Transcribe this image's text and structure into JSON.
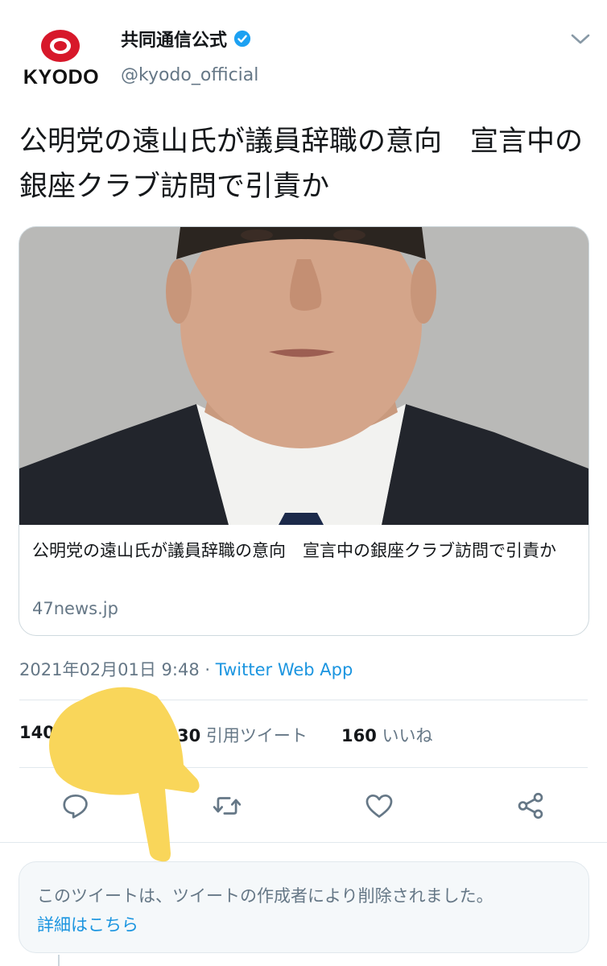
{
  "account": {
    "display_name": "共同通信公式",
    "handle": "@kyodo_official",
    "logo_text": "KYODO",
    "verified": true,
    "logo_color": "#d7182a"
  },
  "tweet": {
    "text": "公明党の遠山氏が議員辞職の意向　宣言中の銀座クラブ訪問で引責か"
  },
  "card": {
    "title": "公明党の遠山氏が議員辞職の意向　宣言中の銀座クラブ訪問で引責か",
    "domain": "47news.jp",
    "image_icon": "portrait-photo"
  },
  "meta": {
    "datetime": "2021年02月01日 9:48",
    "separator": " · ",
    "source": "Twitter Web App"
  },
  "stats": {
    "retweets_count": "140",
    "quote_count": "30",
    "quote_label": "引用ツイート",
    "likes_count": "160",
    "likes_label": "いいね"
  },
  "actions": {
    "reply_icon": "reply-icon",
    "retweet_icon": "retweet-icon",
    "like_icon": "heart-icon",
    "share_icon": "share-icon"
  },
  "notice": {
    "text": "このツイートは、ツイートの作成者により削除されました。",
    "link": "詳細はこちら"
  },
  "colors": {
    "accent": "#1b95e0",
    "muted": "#657786",
    "overlay_hand": "#f9d65a"
  }
}
